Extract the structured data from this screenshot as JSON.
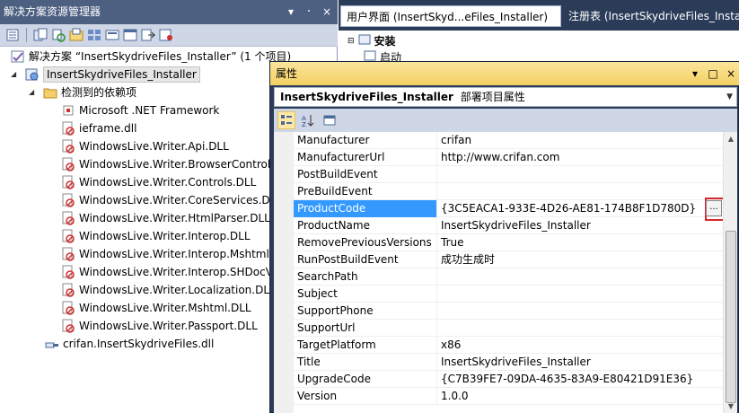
{
  "solution_explorer": {
    "title": "解决方案资源管理器",
    "pin_label": "▾ ᛫ ×",
    "toolbar_icons": [
      "properties-icon",
      "show-all-files-icon",
      "refresh-icon",
      "file-system-editor-icon",
      "registry-editor-icon",
      "file-types-editor-icon",
      "user-interface-editor-icon",
      "custom-actions-editor-icon",
      "launch-conditions-editor-icon"
    ],
    "tree": [
      {
        "label": "解决方案 “InsertSkydriveFiles_Installer” (1 个项目)",
        "icon": "solution-icon",
        "level": 0
      },
      {
        "label": "InsertSkydriveFiles_Installer",
        "icon": "setup-project-icon",
        "level": 1,
        "selected": true
      },
      {
        "label": "检测到的依赖项",
        "icon": "folder-icon",
        "level": 2
      },
      {
        "label": "Microsoft .NET Framework",
        "icon": "framework-icon",
        "level": 3
      },
      {
        "label": "ieframe.dll",
        "icon": "excluded-dll-icon",
        "level": 3
      },
      {
        "label": "WindowsLive.Writer.Api.DLL",
        "icon": "excluded-dll-icon",
        "level": 3
      },
      {
        "label": "WindowsLive.Writer.BrowserControl.",
        "icon": "excluded-dll-icon",
        "level": 3
      },
      {
        "label": "WindowsLive.Writer.Controls.DLL",
        "icon": "excluded-dll-icon",
        "level": 3
      },
      {
        "label": "WindowsLive.Writer.CoreServices.DL",
        "icon": "excluded-dll-icon",
        "level": 3
      },
      {
        "label": "WindowsLive.Writer.HtmlParser.DLL",
        "icon": "excluded-dll-icon",
        "level": 3
      },
      {
        "label": "WindowsLive.Writer.Interop.DLL",
        "icon": "excluded-dll-icon",
        "level": 3
      },
      {
        "label": "WindowsLive.Writer.Interop.Mshtml.",
        "icon": "excluded-dll-icon",
        "level": 3
      },
      {
        "label": "WindowsLive.Writer.Interop.SHDocV",
        "icon": "excluded-dll-icon",
        "level": 3
      },
      {
        "label": "WindowsLive.Writer.Localization.DLL",
        "icon": "excluded-dll-icon",
        "level": 3
      },
      {
        "label": "WindowsLive.Writer.Mshtml.DLL",
        "icon": "excluded-dll-icon",
        "level": 3
      },
      {
        "label": "WindowsLive.Writer.Passport.DLL",
        "icon": "excluded-dll-icon",
        "level": 3
      },
      {
        "label": "crifan.InsertSkydriveFiles.dll",
        "icon": "primary-output-icon",
        "level": 2
      }
    ]
  },
  "document_tabs": {
    "active": "用户界面 (InsertSkyd...eFiles_Installer)",
    "inactive": "注册表 (InsertSkydriveFiles_Installer"
  },
  "document_body": {
    "install_node": "安装",
    "start_node": "启动"
  },
  "properties": {
    "title": "属性",
    "object_name": "InsertSkydriveFiles_Installer",
    "object_type": "部署项目属性",
    "toolbar_icons": [
      "categorized-icon",
      "alphabetical-icon",
      "property-pages-icon"
    ],
    "rows": [
      {
        "name": "Manufacturer",
        "value": "crifan"
      },
      {
        "name": "ManufacturerUrl",
        "value": "http://www.crifan.com"
      },
      {
        "name": "PostBuildEvent",
        "value": ""
      },
      {
        "name": "PreBuildEvent",
        "value": ""
      },
      {
        "name": "ProductCode",
        "value": "{3C5EACA1-933E-4D26-AE81-174B8F1D780D}",
        "selected": true
      },
      {
        "name": "ProductName",
        "value": "InsertSkydriveFiles_Installer"
      },
      {
        "name": "RemovePreviousVersions",
        "value": "True"
      },
      {
        "name": "RunPostBuildEvent",
        "value": "成功生成时"
      },
      {
        "name": "SearchPath",
        "value": ""
      },
      {
        "name": "Subject",
        "value": ""
      },
      {
        "name": "SupportPhone",
        "value": ""
      },
      {
        "name": "SupportUrl",
        "value": ""
      },
      {
        "name": "TargetPlatform",
        "value": "x86"
      },
      {
        "name": "Title",
        "value": "InsertSkydriveFiles_Installer"
      },
      {
        "name": "UpgradeCode",
        "value": "{C7B39FE7-09DA-4635-83A9-E80421D91E36}"
      },
      {
        "name": "Version",
        "value": "1.0.0"
      }
    ],
    "ellipsis_label": "..."
  }
}
